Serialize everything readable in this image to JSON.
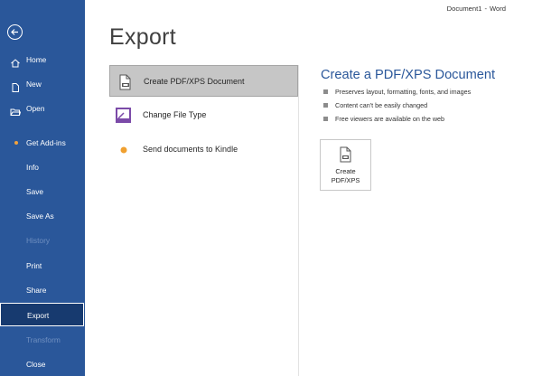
{
  "window": {
    "document": "Document1",
    "app": "Word"
  },
  "sidebar": {
    "colors": {
      "background": "#2a579a",
      "active": "#173a6f",
      "disabled_text": "#6f8fc0",
      "addin_dot": "#f2a23c"
    },
    "items": [
      {
        "label": "Home",
        "icon": "home-icon"
      },
      {
        "label": "New",
        "icon": "new-document-icon"
      },
      {
        "label": "Open",
        "icon": "open-folder-icon"
      },
      {
        "label": "Get Add-ins",
        "icon": "add-ins-dot"
      },
      {
        "label": "Info"
      },
      {
        "label": "Save"
      },
      {
        "label": "Save As"
      },
      {
        "label": "History",
        "state": "disabled"
      },
      {
        "label": "Print"
      },
      {
        "label": "Share"
      },
      {
        "label": "Export",
        "state": "active"
      },
      {
        "label": "Transform",
        "state": "disabled"
      },
      {
        "label": "Close"
      }
    ]
  },
  "page": {
    "title": "Export"
  },
  "options": [
    {
      "label": "Create PDF/XPS Document",
      "icon": "pdf-document-icon",
      "selected": true
    },
    {
      "label": "Change File Type",
      "icon": "change-file-type-icon"
    },
    {
      "label": "Send documents to Kindle",
      "icon": "kindle-dot-icon"
    }
  ],
  "detail": {
    "title": "Create a PDF/XPS Document",
    "title_color": "#2a579a",
    "bullets": [
      "Preserves layout, formatting, fonts, and images",
      "Content can't be easily changed",
      "Free viewers are available on the web"
    ],
    "button_label": "Create\nPDF/XPS",
    "button_icon": "pdf-document-icon"
  }
}
